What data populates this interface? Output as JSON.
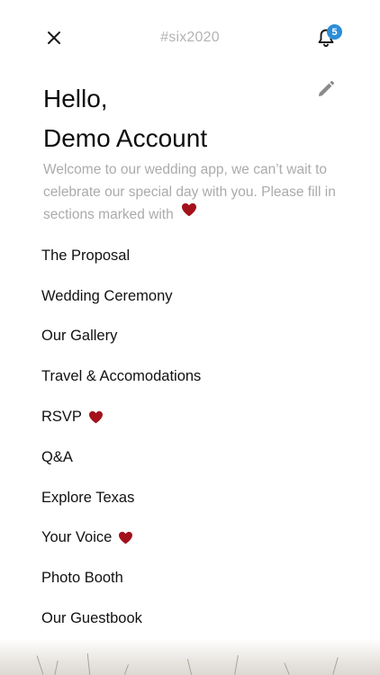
{
  "header": {
    "title": "#six2020",
    "notification_count": "5"
  },
  "greeting": {
    "line1": "Hello,",
    "line2": "Demo Account"
  },
  "welcome_text": "Welcome to our wedding app, we can’t wait to celebrate our special day with you. Please fill in sections marked with",
  "colors": {
    "heart": "#a3111b",
    "badge": "#2c8dd8"
  },
  "menu": {
    "items": [
      {
        "label": "The Proposal",
        "required": false
      },
      {
        "label": "Wedding Ceremony",
        "required": false
      },
      {
        "label": "Our Gallery",
        "required": false
      },
      {
        "label": "Travel & Accomodations",
        "required": false
      },
      {
        "label": "RSVP",
        "required": true
      },
      {
        "label": "Q&A",
        "required": false
      },
      {
        "label": "Explore Texas",
        "required": false
      },
      {
        "label": "Your Voice",
        "required": true
      },
      {
        "label": "Photo Booth",
        "required": false
      },
      {
        "label": "Our Guestbook",
        "required": false
      }
    ]
  }
}
